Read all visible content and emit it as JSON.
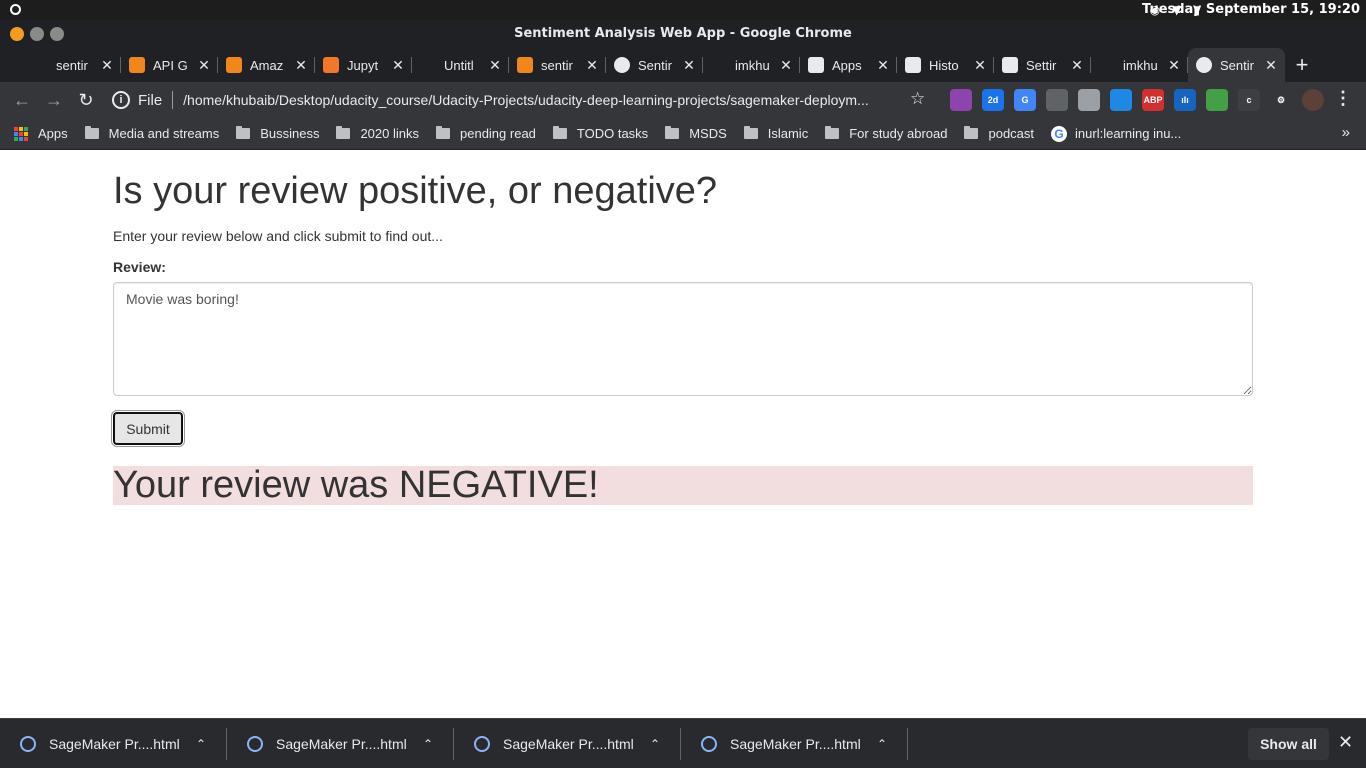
{
  "os": {
    "clock": "Tuesday September 15, 19:20",
    "tray_icons": [
      "settings-icon",
      "wifi-icon",
      "battery-icon"
    ]
  },
  "window": {
    "title": "Sentiment Analysis Web App - Google Chrome"
  },
  "tabs": [
    {
      "label": "sentir",
      "favicon": "blank-icon",
      "color": "#202124"
    },
    {
      "label": "API G",
      "favicon": "aws-icon",
      "color": "#f1861d"
    },
    {
      "label": "Amaz",
      "favicon": "aws-icon",
      "color": "#f1861d"
    },
    {
      "label": "Jupyt",
      "favicon": "jupyter-icon",
      "color": "#f37726"
    },
    {
      "label": "Untitl",
      "favicon": "blank-icon",
      "color": "#202124"
    },
    {
      "label": "sentir",
      "favicon": "lambda-icon",
      "color": "#f1861d"
    },
    {
      "label": "Sentir",
      "favicon": "globe-icon",
      "color": "#e8eaed"
    },
    {
      "label": "imkhu",
      "favicon": "blank-icon",
      "color": "#202124"
    },
    {
      "label": "Apps",
      "favicon": "apps-grid-icon",
      "color": "#e8eaed"
    },
    {
      "label": "Histo",
      "favicon": "history-icon",
      "color": "#e8eaed"
    },
    {
      "label": "Settir",
      "favicon": "gear-icon",
      "color": "#e8eaed"
    },
    {
      "label": "imkhu",
      "favicon": "blank-icon",
      "color": "#202124"
    },
    {
      "label": "Sentir",
      "favicon": "globe-icon",
      "color": "#e8eaed",
      "active": true
    }
  ],
  "toolbar": {
    "scheme": "File",
    "url": "/home/khubaib/Desktop/udacity_course/Udacity-Projects/udacity-deep-learning-projects/sagemaker-deploym...",
    "extensions": [
      {
        "name": "feather-extension-icon",
        "color": "#8e44ad",
        "text": ""
      },
      {
        "name": "calendar-extension-icon",
        "color": "#1a73e8",
        "text": "2d"
      },
      {
        "name": "translate-extension-icon",
        "color": "#4285f4",
        "text": "G"
      },
      {
        "name": "globe-extension-icon",
        "color": "#5f6368",
        "text": ""
      },
      {
        "name": "cat-extension-icon",
        "color": "#9aa0a6",
        "text": ""
      },
      {
        "name": "diamond-extension-icon",
        "color": "#1e88e5",
        "text": ""
      },
      {
        "name": "adblock-extension-icon",
        "color": "#d32f2f",
        "text": "ABP"
      },
      {
        "name": "analytics-extension-icon",
        "color": "#1565c0",
        "text": "ılı"
      },
      {
        "name": "print-extension-icon",
        "color": "#43a047",
        "text": ""
      },
      {
        "name": "bug-extension-icon",
        "color": "#3c4043",
        "text": "c"
      },
      {
        "name": "puzzle-extensions-icon",
        "color": "#35363a",
        "text": "⚙"
      },
      {
        "name": "profile-avatar",
        "color": "#5d4037",
        "text": ""
      }
    ]
  },
  "bookmarks": [
    {
      "label": "Apps",
      "type": "apps"
    },
    {
      "label": "Media and streams",
      "type": "folder"
    },
    {
      "label": "Bussiness",
      "type": "folder"
    },
    {
      "label": "2020 links",
      "type": "folder"
    },
    {
      "label": "pending read",
      "type": "folder"
    },
    {
      "label": "TODO tasks",
      "type": "folder"
    },
    {
      "label": "MSDS",
      "type": "folder"
    },
    {
      "label": "Islamic",
      "type": "folder"
    },
    {
      "label": "For study abroad",
      "type": "folder"
    },
    {
      "label": "podcast",
      "type": "folder"
    },
    {
      "label": "inurl:learning inu...",
      "type": "google"
    }
  ],
  "page": {
    "heading": "Is your review positive, or negative?",
    "subtitle": "Enter your review below and click submit to find out...",
    "review_label": "Review:",
    "review_value": "Movie was boring!",
    "submit_label": "Submit",
    "result_text": "Your review was NEGATIVE!",
    "result_bg": "#f2dede"
  },
  "downloads": {
    "items": [
      {
        "name": "SageMaker Pr....html"
      },
      {
        "name": "SageMaker Pr....html"
      },
      {
        "name": "SageMaker Pr....html"
      },
      {
        "name": "SageMaker Pr....html"
      }
    ],
    "show_all": "Show all"
  }
}
